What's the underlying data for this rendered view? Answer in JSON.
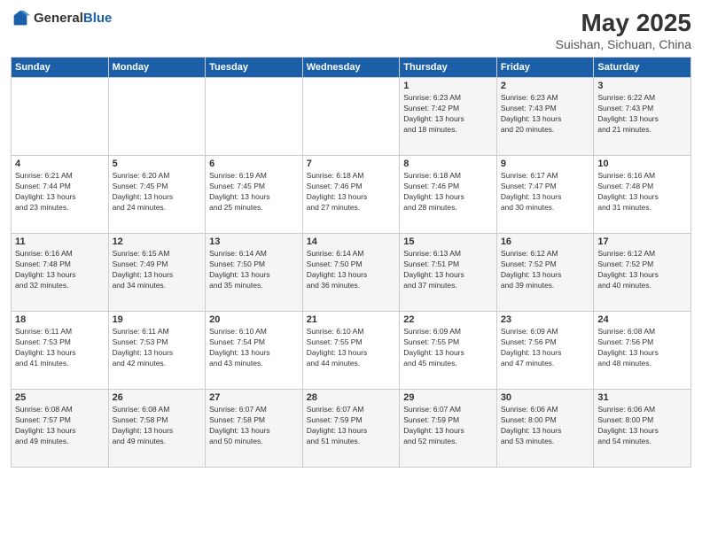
{
  "header": {
    "logo_general": "General",
    "logo_blue": "Blue",
    "month": "May 2025",
    "location": "Suishan, Sichuan, China"
  },
  "weekdays": [
    "Sunday",
    "Monday",
    "Tuesday",
    "Wednesday",
    "Thursday",
    "Friday",
    "Saturday"
  ],
  "weeks": [
    [
      {
        "day": "",
        "info": ""
      },
      {
        "day": "",
        "info": ""
      },
      {
        "day": "",
        "info": ""
      },
      {
        "day": "",
        "info": ""
      },
      {
        "day": "1",
        "info": "Sunrise: 6:23 AM\nSunset: 7:42 PM\nDaylight: 13 hours\nand 18 minutes."
      },
      {
        "day": "2",
        "info": "Sunrise: 6:23 AM\nSunset: 7:43 PM\nDaylight: 13 hours\nand 20 minutes."
      },
      {
        "day": "3",
        "info": "Sunrise: 6:22 AM\nSunset: 7:43 PM\nDaylight: 13 hours\nand 21 minutes."
      }
    ],
    [
      {
        "day": "4",
        "info": "Sunrise: 6:21 AM\nSunset: 7:44 PM\nDaylight: 13 hours\nand 23 minutes."
      },
      {
        "day": "5",
        "info": "Sunrise: 6:20 AM\nSunset: 7:45 PM\nDaylight: 13 hours\nand 24 minutes."
      },
      {
        "day": "6",
        "info": "Sunrise: 6:19 AM\nSunset: 7:45 PM\nDaylight: 13 hours\nand 25 minutes."
      },
      {
        "day": "7",
        "info": "Sunrise: 6:18 AM\nSunset: 7:46 PM\nDaylight: 13 hours\nand 27 minutes."
      },
      {
        "day": "8",
        "info": "Sunrise: 6:18 AM\nSunset: 7:46 PM\nDaylight: 13 hours\nand 28 minutes."
      },
      {
        "day": "9",
        "info": "Sunrise: 6:17 AM\nSunset: 7:47 PM\nDaylight: 13 hours\nand 30 minutes."
      },
      {
        "day": "10",
        "info": "Sunrise: 6:16 AM\nSunset: 7:48 PM\nDaylight: 13 hours\nand 31 minutes."
      }
    ],
    [
      {
        "day": "11",
        "info": "Sunrise: 6:16 AM\nSunset: 7:48 PM\nDaylight: 13 hours\nand 32 minutes."
      },
      {
        "day": "12",
        "info": "Sunrise: 6:15 AM\nSunset: 7:49 PM\nDaylight: 13 hours\nand 34 minutes."
      },
      {
        "day": "13",
        "info": "Sunrise: 6:14 AM\nSunset: 7:50 PM\nDaylight: 13 hours\nand 35 minutes."
      },
      {
        "day": "14",
        "info": "Sunrise: 6:14 AM\nSunset: 7:50 PM\nDaylight: 13 hours\nand 36 minutes."
      },
      {
        "day": "15",
        "info": "Sunrise: 6:13 AM\nSunset: 7:51 PM\nDaylight: 13 hours\nand 37 minutes."
      },
      {
        "day": "16",
        "info": "Sunrise: 6:12 AM\nSunset: 7:52 PM\nDaylight: 13 hours\nand 39 minutes."
      },
      {
        "day": "17",
        "info": "Sunrise: 6:12 AM\nSunset: 7:52 PM\nDaylight: 13 hours\nand 40 minutes."
      }
    ],
    [
      {
        "day": "18",
        "info": "Sunrise: 6:11 AM\nSunset: 7:53 PM\nDaylight: 13 hours\nand 41 minutes."
      },
      {
        "day": "19",
        "info": "Sunrise: 6:11 AM\nSunset: 7:53 PM\nDaylight: 13 hours\nand 42 minutes."
      },
      {
        "day": "20",
        "info": "Sunrise: 6:10 AM\nSunset: 7:54 PM\nDaylight: 13 hours\nand 43 minutes."
      },
      {
        "day": "21",
        "info": "Sunrise: 6:10 AM\nSunset: 7:55 PM\nDaylight: 13 hours\nand 44 minutes."
      },
      {
        "day": "22",
        "info": "Sunrise: 6:09 AM\nSunset: 7:55 PM\nDaylight: 13 hours\nand 45 minutes."
      },
      {
        "day": "23",
        "info": "Sunrise: 6:09 AM\nSunset: 7:56 PM\nDaylight: 13 hours\nand 47 minutes."
      },
      {
        "day": "24",
        "info": "Sunrise: 6:08 AM\nSunset: 7:56 PM\nDaylight: 13 hours\nand 48 minutes."
      }
    ],
    [
      {
        "day": "25",
        "info": "Sunrise: 6:08 AM\nSunset: 7:57 PM\nDaylight: 13 hours\nand 49 minutes."
      },
      {
        "day": "26",
        "info": "Sunrise: 6:08 AM\nSunset: 7:58 PM\nDaylight: 13 hours\nand 49 minutes."
      },
      {
        "day": "27",
        "info": "Sunrise: 6:07 AM\nSunset: 7:58 PM\nDaylight: 13 hours\nand 50 minutes."
      },
      {
        "day": "28",
        "info": "Sunrise: 6:07 AM\nSunset: 7:59 PM\nDaylight: 13 hours\nand 51 minutes."
      },
      {
        "day": "29",
        "info": "Sunrise: 6:07 AM\nSunset: 7:59 PM\nDaylight: 13 hours\nand 52 minutes."
      },
      {
        "day": "30",
        "info": "Sunrise: 6:06 AM\nSunset: 8:00 PM\nDaylight: 13 hours\nand 53 minutes."
      },
      {
        "day": "31",
        "info": "Sunrise: 6:06 AM\nSunset: 8:00 PM\nDaylight: 13 hours\nand 54 minutes."
      }
    ]
  ]
}
